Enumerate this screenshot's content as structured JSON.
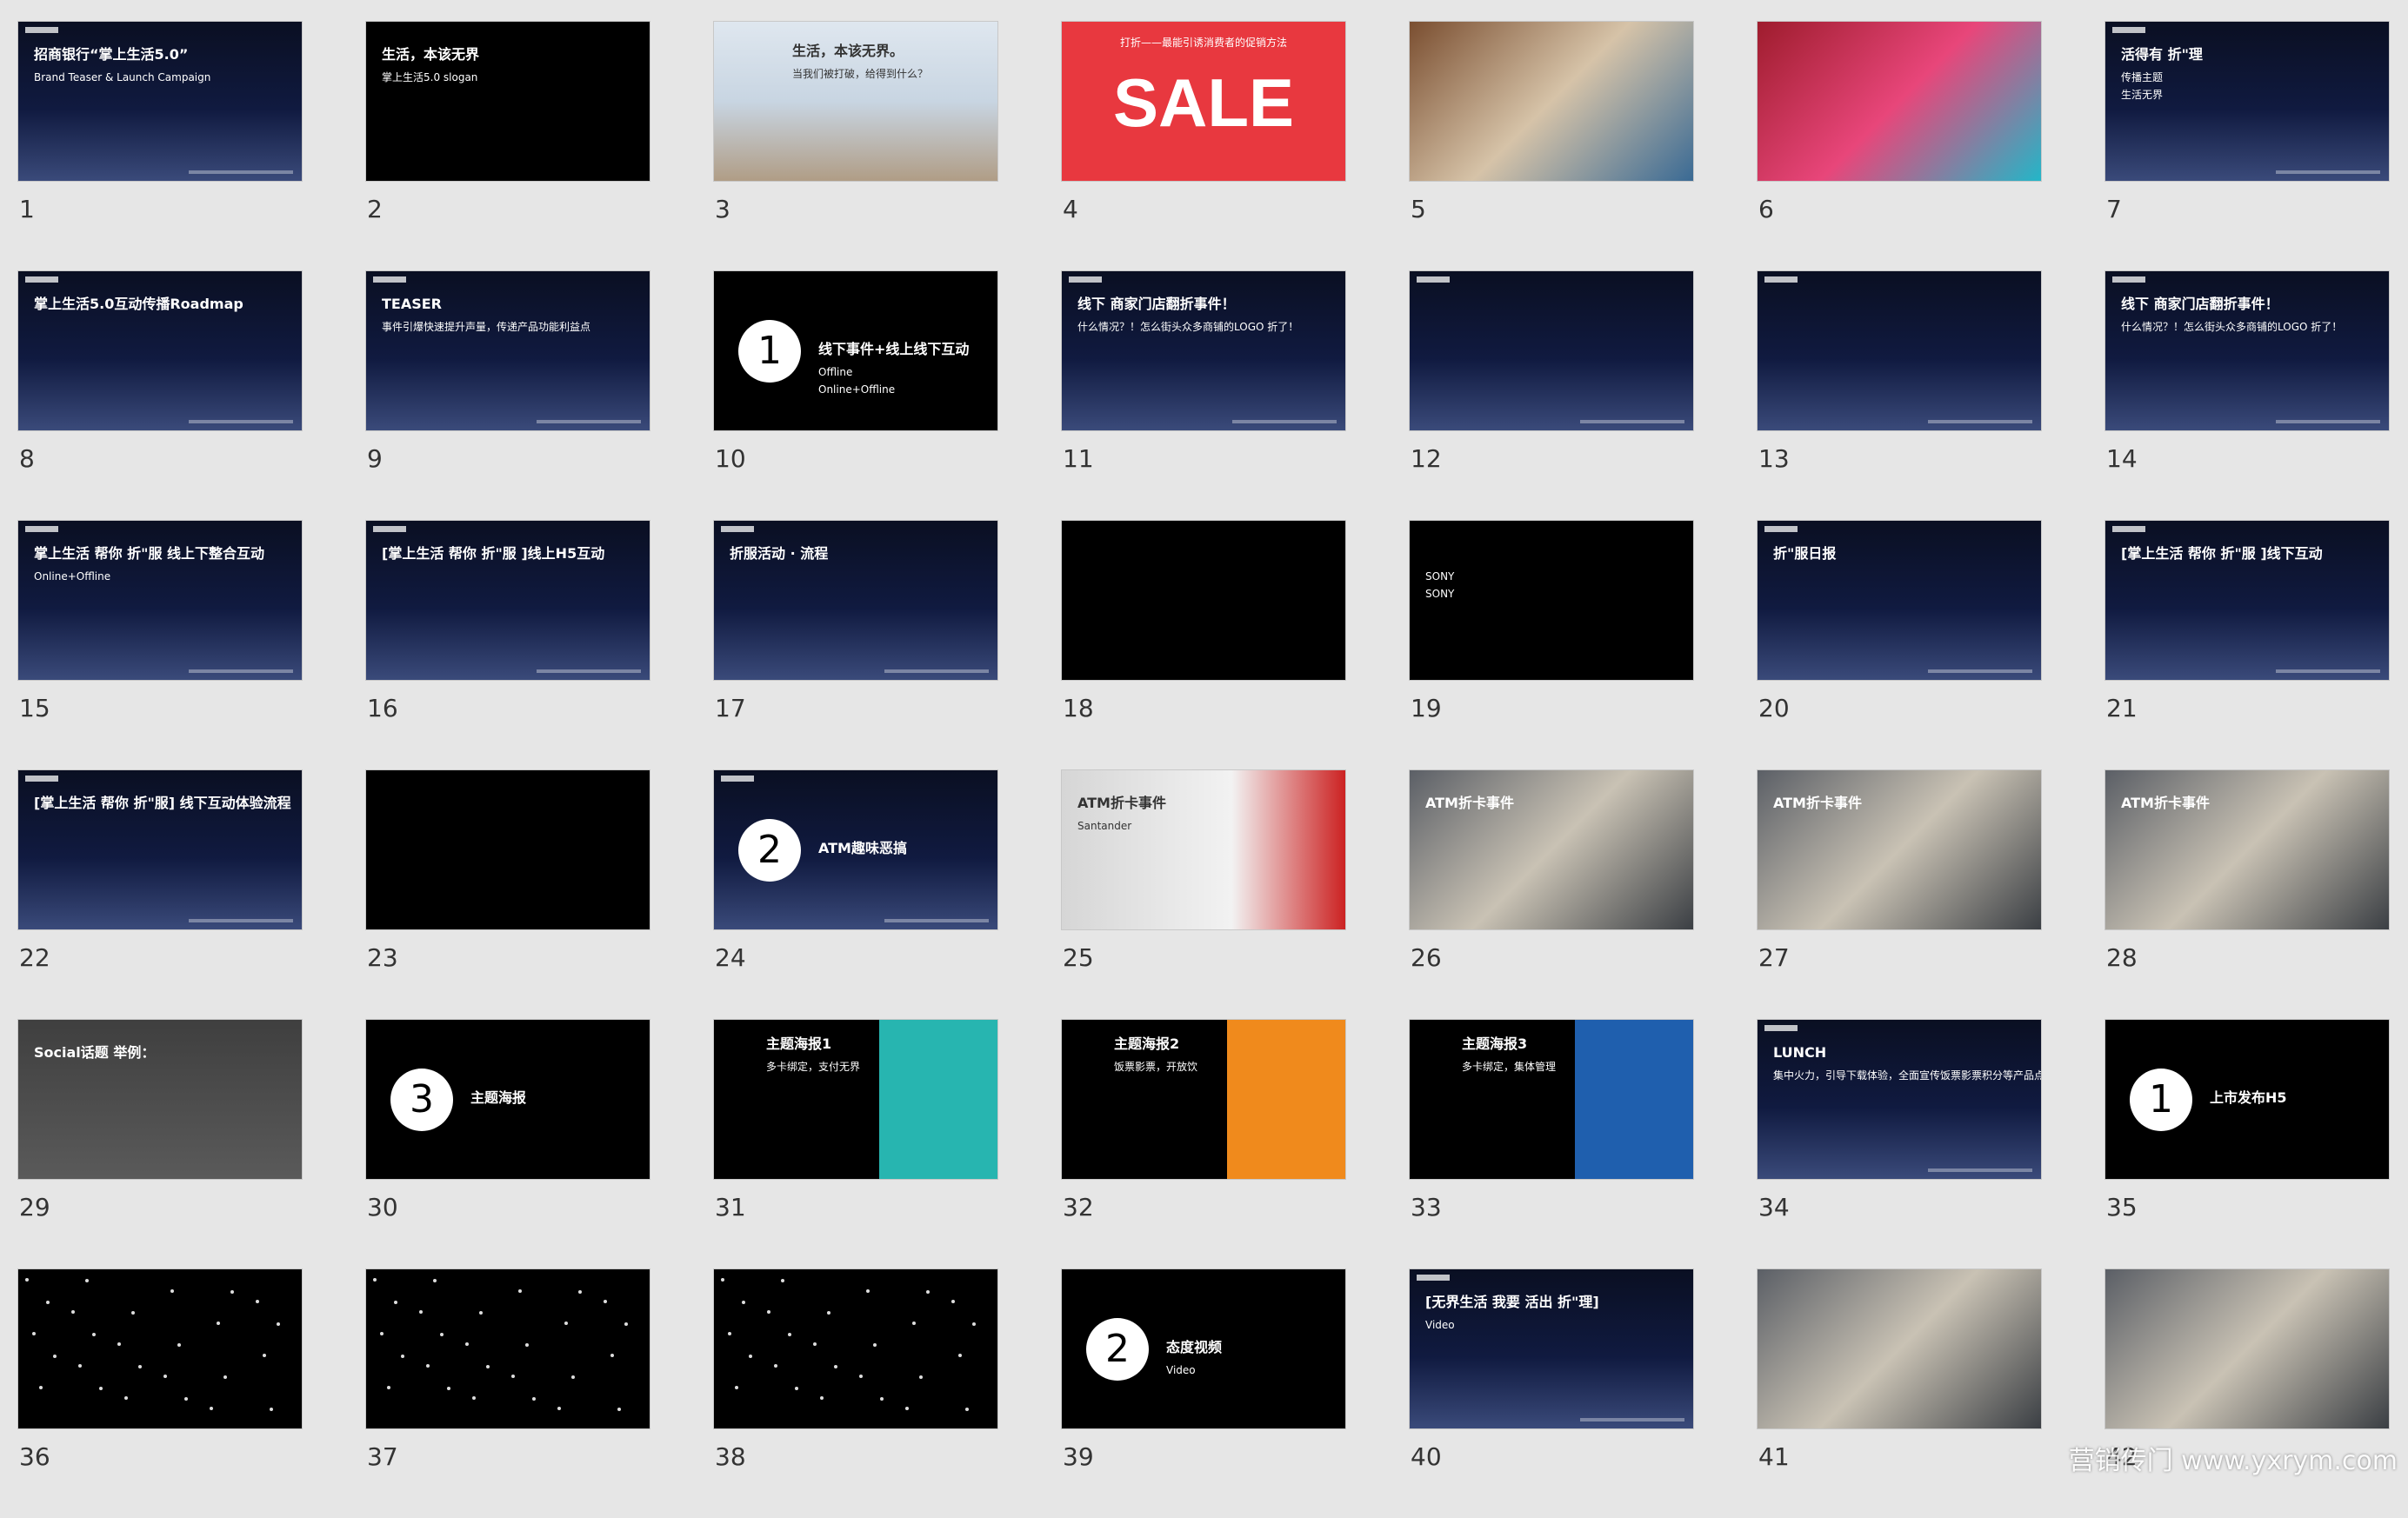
{
  "slides": [
    {
      "n": "1",
      "bg": "navy",
      "title": "招商银行“掌上生活5.0”",
      "lines": [
        "Brand Teaser & Launch Campaign"
      ]
    },
    {
      "n": "2",
      "bg": "black",
      "title": "生活，本该无界",
      "lines": [
        "掌上生活5.0 slogan"
      ]
    },
    {
      "n": "3",
      "bg": "sky",
      "title": "生活，本该无界。",
      "lines": [
        "当我们被打破，给得到什么？"
      ]
    },
    {
      "n": "4",
      "bg": "red",
      "title": "打折——最能引诱消费者的促销方法",
      "lines": [
        "SALE"
      ]
    },
    {
      "n": "5",
      "bg": "cafe",
      "title": "",
      "lines": []
    },
    {
      "n": "6",
      "bg": "shop",
      "title": "",
      "lines": []
    },
    {
      "n": "7",
      "bg": "navy",
      "title": "活得有 折\"理",
      "lines": [
        "传播主题",
        "生活无界"
      ]
    },
    {
      "n": "8",
      "bg": "navy",
      "title": "掌上生活5.0互动传播Roadmap",
      "lines": []
    },
    {
      "n": "9",
      "bg": "navy",
      "title": "TEASER",
      "lines": [
        "事件引爆快速提升声量，传递产品功能利益点"
      ]
    },
    {
      "n": "10",
      "bg": "black",
      "title": "线下事件+线上线下互动",
      "lines": [
        "Offline",
        "Online+Offline"
      ],
      "circle": "1"
    },
    {
      "n": "11",
      "bg": "navy",
      "title": "线下 商家门店翻折事件！",
      "lines": [
        "什么情况？！怎么街头众多商铺的LOGO 折了！"
      ]
    },
    {
      "n": "12",
      "bg": "navy",
      "title": "",
      "lines": []
    },
    {
      "n": "13",
      "bg": "navy",
      "title": "",
      "lines": []
    },
    {
      "n": "14",
      "bg": "navy",
      "title": "线下 商家门店翻折事件！",
      "lines": [
        "什么情况？！怎么街头众多商铺的LOGO 折了！"
      ]
    },
    {
      "n": "15",
      "bg": "navy",
      "title": "掌上生活 帮你 折\"服 线上下整合互动",
      "lines": [
        "Online+Offline"
      ]
    },
    {
      "n": "16",
      "bg": "navy",
      "title": "[掌上生活 帮你 折\"服 ]线上H5互动",
      "lines": []
    },
    {
      "n": "17",
      "bg": "navy",
      "title": "折服活动 · 流程",
      "lines": []
    },
    {
      "n": "18",
      "bg": "black",
      "title": "",
      "lines": []
    },
    {
      "n": "19",
      "bg": "black",
      "title": "",
      "lines": [
        "SONY",
        "SONY"
      ]
    },
    {
      "n": "20",
      "bg": "navy",
      "title": "折\"服日报",
      "lines": []
    },
    {
      "n": "21",
      "bg": "navy",
      "title": "[掌上生活 帮你 折\"服 ]线下互动",
      "lines": []
    },
    {
      "n": "22",
      "bg": "navy",
      "title": "[掌上生活 帮你 折\"服] 线下互动体验流程",
      "lines": []
    },
    {
      "n": "23",
      "bg": "black",
      "title": "",
      "lines": []
    },
    {
      "n": "24",
      "bg": "navy",
      "title": "ATM趣味恶搞",
      "lines": [],
      "circle": "2"
    },
    {
      "n": "25",
      "bg": "kiosk",
      "title": "ATM折卡事件",
      "lines": [
        "Santander"
      ]
    },
    {
      "n": "26",
      "bg": "photo",
      "title": "ATM折卡事件",
      "lines": []
    },
    {
      "n": "27",
      "bg": "photo",
      "title": "ATM折卡事件",
      "lines": []
    },
    {
      "n": "28",
      "bg": "photo",
      "title": "ATM折卡事件",
      "lines": []
    },
    {
      "n": "29",
      "bg": "chalk",
      "title": "Social话题 举例：",
      "lines": []
    },
    {
      "n": "30",
      "bg": "black",
      "title": "主题海报",
      "lines": [],
      "circle": "3"
    },
    {
      "n": "31",
      "bg": "black",
      "title": "主题海报1",
      "lines": [
        "多卡绑定，支付无界"
      ],
      "poster": "#27b5b0"
    },
    {
      "n": "32",
      "bg": "black",
      "title": "主题海报2",
      "lines": [
        "饭票影票，开放饮"
      ],
      "poster": "#f08a1c"
    },
    {
      "n": "33",
      "bg": "black",
      "title": "主题海报3",
      "lines": [
        "多卡绑定，集体管理"
      ],
      "poster": "#1f5fae"
    },
    {
      "n": "34",
      "bg": "navy",
      "title": "LUNCH",
      "lines": [
        "集中火力，引导下载体验，全面宣传饭票影票积分等产品点。"
      ]
    },
    {
      "n": "35",
      "bg": "black",
      "title": "上市发布H5",
      "lines": [],
      "circle": "1"
    },
    {
      "n": "36",
      "bg": "black",
      "title": "",
      "lines": [],
      "stars": true
    },
    {
      "n": "37",
      "bg": "black",
      "title": "",
      "lines": [],
      "stars": true
    },
    {
      "n": "38",
      "bg": "black",
      "title": "",
      "lines": [],
      "stars": true
    },
    {
      "n": "39",
      "bg": "black",
      "title": "态度视频",
      "lines": [
        "Video"
      ],
      "circle": "2"
    },
    {
      "n": "40",
      "bg": "navy",
      "title": "[无界生活 我要 活出 折\"理]",
      "lines": [
        "Video"
      ]
    },
    {
      "n": "41",
      "bg": "photo",
      "title": "",
      "lines": []
    },
    {
      "n": "42",
      "bg": "photo",
      "title": "",
      "lines": []
    }
  ],
  "watermark": "营销传门 www.yxrym.com"
}
